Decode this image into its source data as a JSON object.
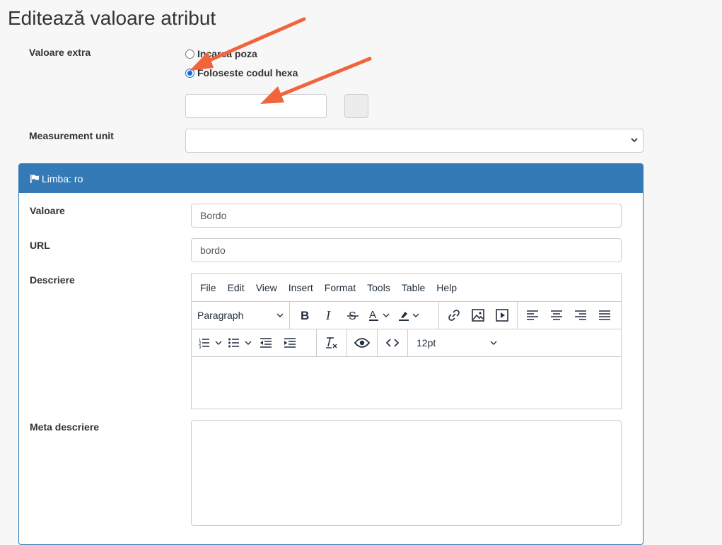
{
  "page": {
    "title": "Editează valoare atribut"
  },
  "extra": {
    "label": "Valoare extra",
    "options": [
      {
        "label": "Incarca poza",
        "checked": false
      },
      {
        "label": "Foloseste codul hexa",
        "checked": true
      }
    ],
    "hex_value": "",
    "swatch_color": "#ececec"
  },
  "measurement": {
    "label": "Measurement unit",
    "selected": ""
  },
  "panel": {
    "heading": "Limba: ro",
    "value": {
      "label": "Valoare",
      "value": "Bordo"
    },
    "url": {
      "label": "URL",
      "value": "bordo"
    },
    "description": {
      "label": "Descriere",
      "menu": [
        "File",
        "Edit",
        "View",
        "Insert",
        "Format",
        "Tools",
        "Table",
        "Help"
      ],
      "block_format": "Paragraph",
      "font_size": "12pt"
    },
    "meta": {
      "label": "Meta descriere",
      "value": ""
    }
  },
  "colors": {
    "panel_blue": "#337ab7",
    "arrow": "#f0653b",
    "radio_blue": "#0b6bdb"
  }
}
